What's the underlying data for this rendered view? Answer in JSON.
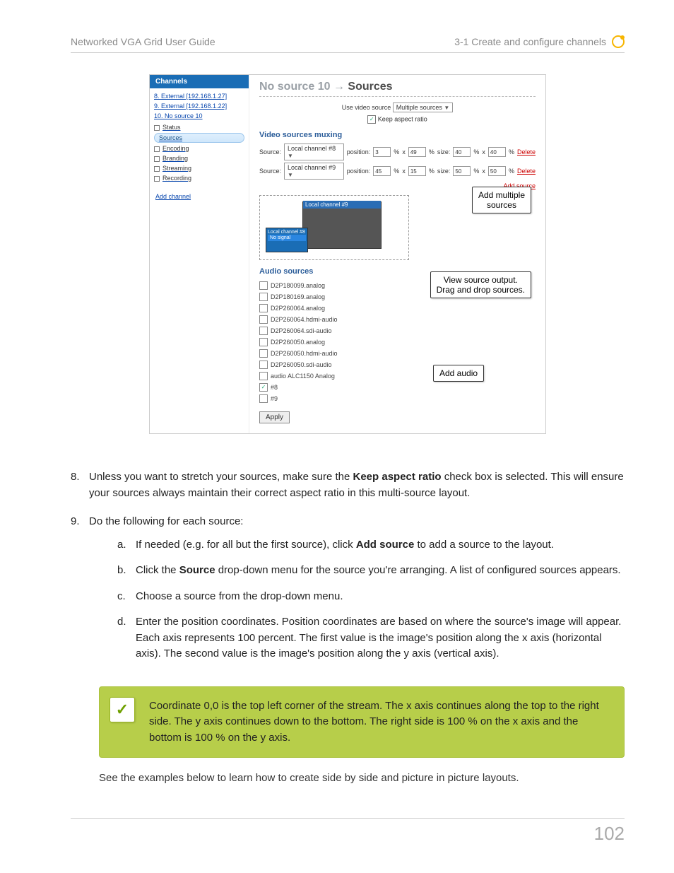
{
  "header": {
    "left": "Networked VGA Grid User Guide",
    "right": "3-1 Create and configure channels"
  },
  "screenshot": {
    "sidebar": {
      "header": "Channels",
      "items": [
        "8. External [192.168.1.27]",
        "9. External [192.168.1.22]",
        "10. No source 10"
      ],
      "sub": [
        "Status",
        "Sources",
        "Encoding",
        "Branding",
        "Streaming",
        "Recording"
      ],
      "add": "Add channel"
    },
    "main": {
      "title_left": "No source 10",
      "title_arrow": "→",
      "title_right": "Sources",
      "use_video_label": "Use video source",
      "use_video_value": "Multiple sources",
      "keep_aspect": "Keep aspect ratio",
      "muxing_header": "Video sources muxing",
      "rows": [
        {
          "source": "Local channel #8",
          "pos1": "3",
          "pos2": "49",
          "size1": "40",
          "size2": "40"
        },
        {
          "source": "Local channel #9",
          "pos1": "45",
          "pos2": "15",
          "size1": "50",
          "size2": "50"
        }
      ],
      "labels": {
        "source": "Source:",
        "position": "position:",
        "size": "size:",
        "pct": "%",
        "x": "x",
        "delete": "Delete",
        "add_source": "Add source"
      },
      "preview": {
        "big": "Local channel #9",
        "small": "Local channel #8",
        "nosignal": "No signal"
      },
      "audio_header": "Audio sources",
      "audio": [
        "D2P180099.analog",
        "D2P180169.analog",
        "D2P260064.analog",
        "D2P260064.hdmi-audio",
        "D2P260064.sdi-audio",
        "D2P260050.analog",
        "D2P260050.hdmi-audio",
        "D2P260050.sdi-audio",
        "audio ALC1150 Analog"
      ],
      "audio_checked": [
        "#8",
        "#9"
      ],
      "apply": "Apply"
    },
    "callouts": {
      "c1a": "Add multiple",
      "c1b": "sources",
      "c2a": "View source output.",
      "c2b": "Drag and drop sources.",
      "c3": "Add audio"
    }
  },
  "steps": {
    "s8": {
      "n": "8.",
      "t1": "Unless you want to stretch your sources, make sure the ",
      "b": "Keep aspect ratio",
      "t2": " check box is selected. This will ensure your sources always maintain their correct aspect ratio in this multi-source layout."
    },
    "s9": {
      "n": "9.",
      "t": "Do the following for each source:"
    },
    "a": {
      "n": "a.",
      "t1": "If needed (e.g. for all but the first source), click ",
      "b": "Add source",
      "t2": " to add a source to the layout."
    },
    "b": {
      "n": "b.",
      "t1": "Click the ",
      "bo": "Source",
      "t2": " drop-down menu for the source you're arranging. A list of configured sources appears."
    },
    "c": {
      "n": "c.",
      "t": "Choose a source from the drop-down menu."
    },
    "d": {
      "n": "d.",
      "t": "Enter the position coordinates. Position coordinates are based on where the source's image will appear. Each axis represents 100 percent. The first value is the image's position along the x axis (horizontal axis). The second value is the image's position along the y axis (vertical axis)."
    }
  },
  "note": "Coordinate 0,0 is the top left corner of the stream. The x axis continues along the top to the right side. The y axis continues down to the bottom. The right side is 100 % on the x axis and the bottom is 100 % on the y axis.",
  "see": "See the examples below to learn how to create side by side and picture in picture layouts.",
  "page_number": "102"
}
